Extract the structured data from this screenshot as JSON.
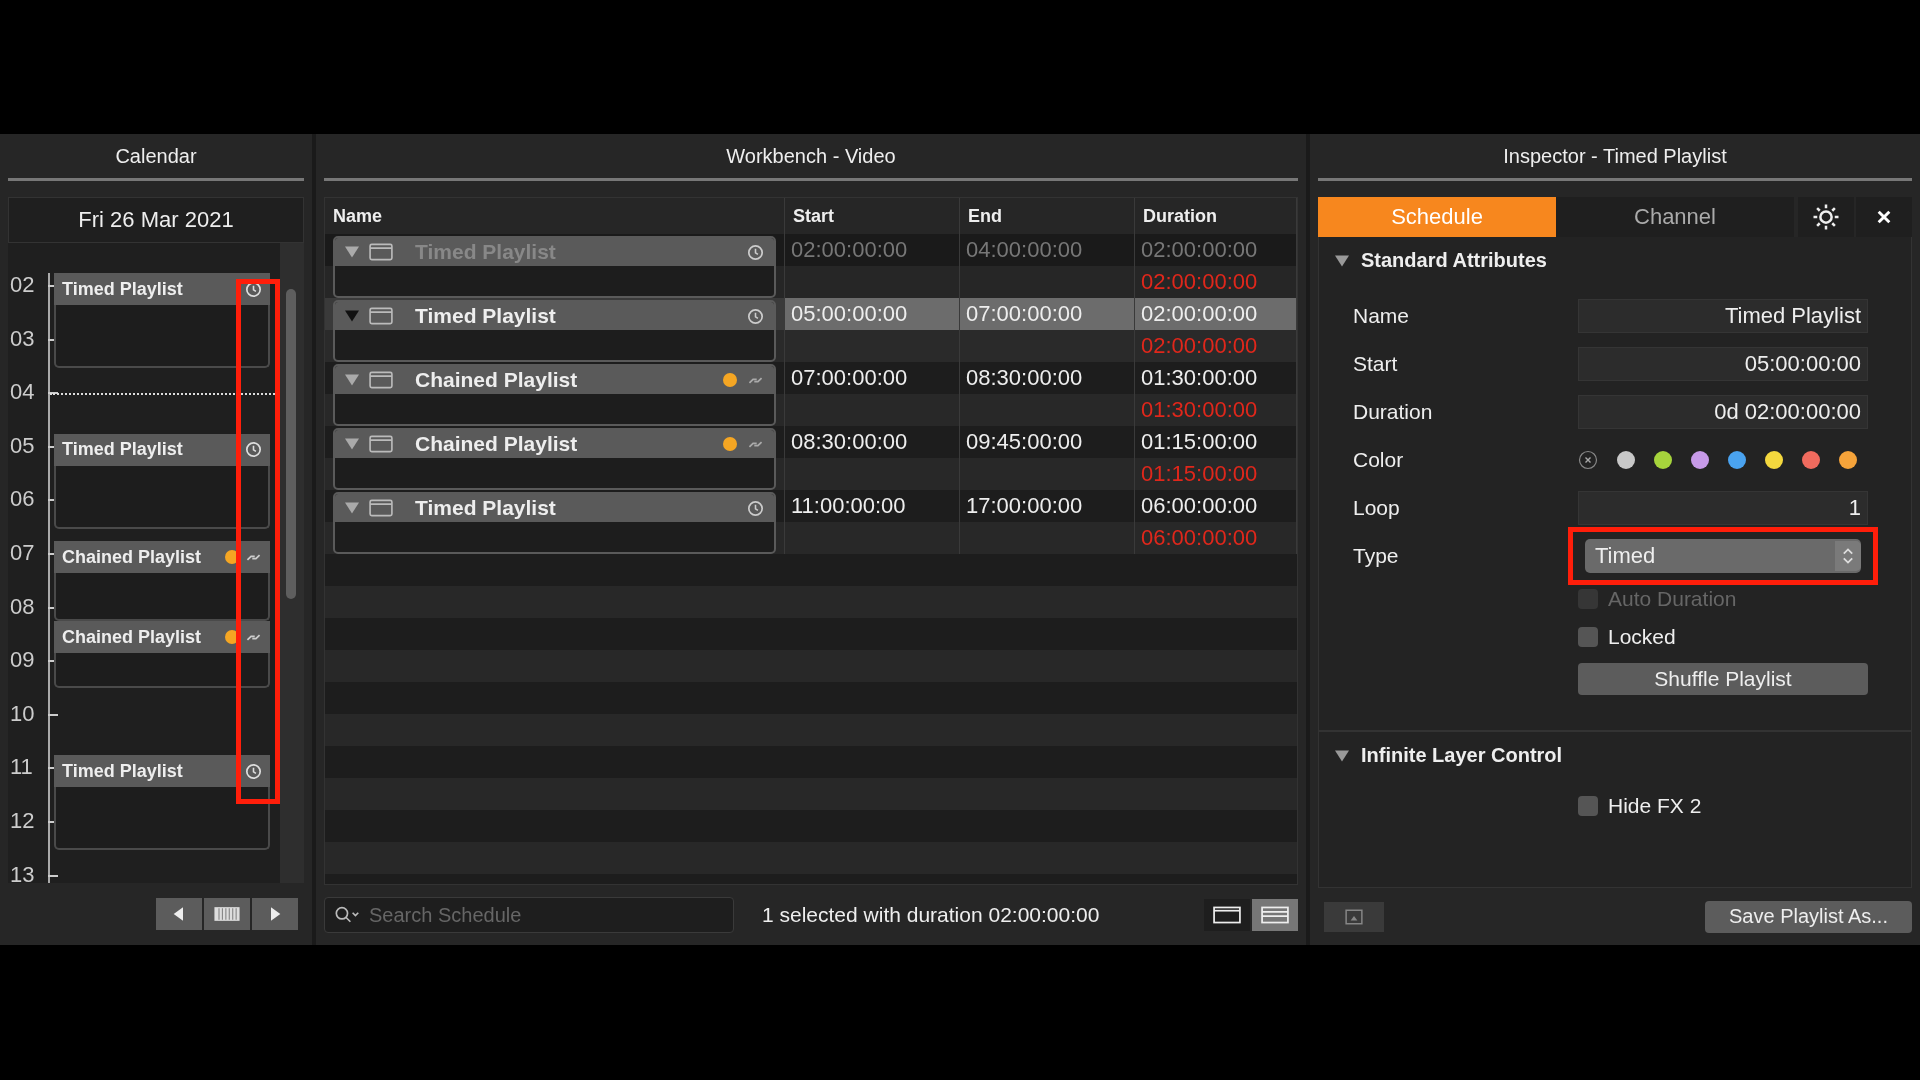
{
  "calendar": {
    "title": "Calendar",
    "date": "Fri 26 Mar 2021",
    "hours": [
      "02",
      "03",
      "04",
      "05",
      "06",
      "07",
      "08",
      "09",
      "10",
      "11",
      "12",
      "13"
    ],
    "events": [
      {
        "name": "Timed Playlist",
        "kind": "timed"
      },
      {
        "name": "Timed Playlist",
        "kind": "timed"
      },
      {
        "name": "Chained Playlist",
        "kind": "chained",
        "color": "#f5a623"
      },
      {
        "name": "Chained Playlist",
        "kind": "chained",
        "color": "#f5a623"
      },
      {
        "name": "Timed Playlist",
        "kind": "timed"
      }
    ]
  },
  "workbench": {
    "title": "Workbench - Video",
    "columns": [
      "Name",
      "Start",
      "End",
      "Duration"
    ],
    "rows": [
      {
        "name": "Timed Playlist",
        "kind": "timed",
        "disabled": true,
        "selected": false,
        "start": "02:00:00:00",
        "end": "04:00:00:00",
        "duration": "02:00:00:00",
        "duration_line_2": "02:00:00:00"
      },
      {
        "name": "Timed Playlist",
        "kind": "timed",
        "disabled": false,
        "selected": true,
        "start": "05:00:00:00",
        "end": "07:00:00:00",
        "duration": "02:00:00:00",
        "duration_line_2": "02:00:00:00"
      },
      {
        "name": "Chained Playlist",
        "kind": "chained",
        "color": "#f5a623",
        "disabled": false,
        "selected": false,
        "start": "07:00:00:00",
        "end": "08:30:00:00",
        "duration": "01:30:00:00",
        "duration_line_2": "01:30:00:00"
      },
      {
        "name": "Chained Playlist",
        "kind": "chained",
        "color": "#f5a623",
        "disabled": false,
        "selected": false,
        "start": "08:30:00:00",
        "end": "09:45:00:00",
        "duration": "01:15:00:00",
        "duration_line_2": "01:15:00:00"
      },
      {
        "name": "Timed Playlist",
        "kind": "timed",
        "disabled": false,
        "selected": false,
        "start": "11:00:00:00",
        "end": "17:00:00:00",
        "duration": "06:00:00:00",
        "duration_line_2": "06:00:00:00"
      }
    ],
    "search": {
      "placeholder": "Search Schedule"
    },
    "status": "1 selected with duration 02:00:00:00",
    "view_buttons": [
      {
        "kind": "single",
        "selected": false
      },
      {
        "kind": "split",
        "selected": true
      }
    ]
  },
  "inspector": {
    "title": "Inspector - Timed Playlist",
    "tabs": [
      {
        "label": "Schedule",
        "selected": true
      },
      {
        "label": "Channel",
        "selected": false
      }
    ],
    "section": {
      "title": "Standard Attributes",
      "expanded": true
    },
    "fields": [
      {
        "label": "Name",
        "value": "Timed Playlist"
      },
      {
        "label": "Start",
        "value": "05:00:00:00"
      },
      {
        "label": "Duration",
        "value": "0d 02:00:00:00"
      }
    ],
    "color_label": "Color",
    "colors": [
      {
        "kind": "none"
      },
      {
        "kind": "swatch",
        "color": "#c8c8c8"
      },
      {
        "kind": "swatch",
        "color": "#a6d43c"
      },
      {
        "kind": "swatch",
        "color": "#c79ae8"
      },
      {
        "kind": "swatch",
        "color": "#4aa3f0"
      },
      {
        "kind": "swatch",
        "color": "#f4d83e"
      },
      {
        "kind": "swatch",
        "color": "#f06b5e"
      },
      {
        "kind": "swatch",
        "color": "#f5a33a"
      }
    ],
    "loop": {
      "label": "Loop",
      "value": "1"
    },
    "type": {
      "label": "Type",
      "value": "Timed"
    },
    "checkboxes": [
      {
        "label": "Auto Duration",
        "checked": false,
        "disabled": true
      },
      {
        "label": "Locked",
        "checked": false,
        "disabled": false
      }
    ],
    "shuffle_button": "Shuffle Playlist",
    "section_2": {
      "title": "Infinite Layer Control",
      "expanded": true
    },
    "checkboxes_2": [
      {
        "label": "Hide FX 2",
        "checked": false,
        "disabled": false
      }
    ],
    "save_button": "Save Playlist As..."
  }
}
